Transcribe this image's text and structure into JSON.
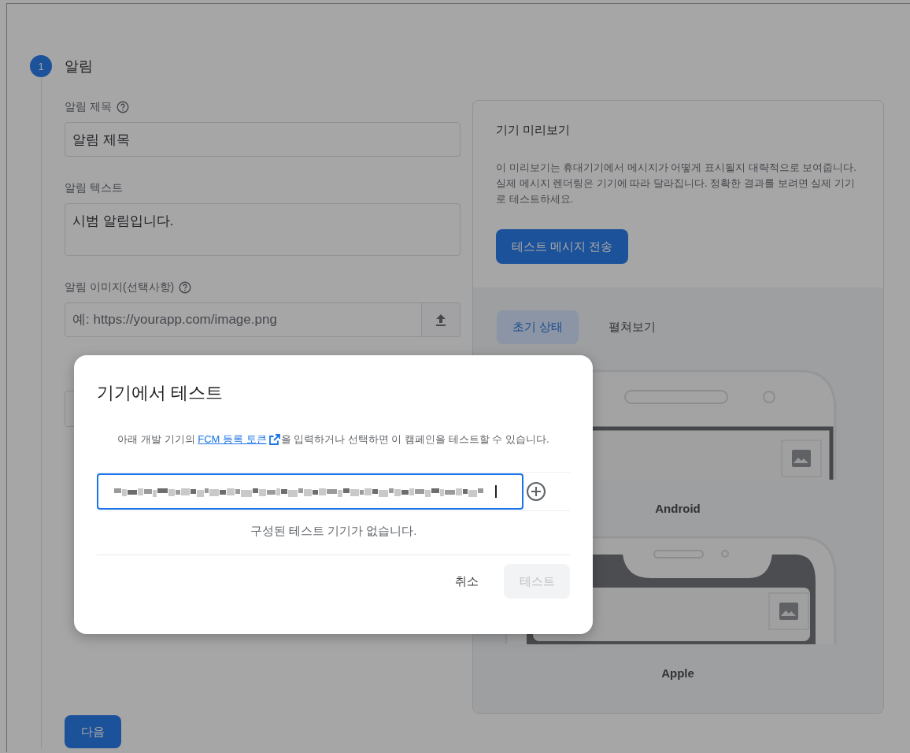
{
  "step": {
    "number": "1",
    "title": "알림"
  },
  "fields": [
    {
      "kind": "text",
      "label": "알림 제목",
      "help": true,
      "value": "알림 제목"
    },
    {
      "kind": "textarea",
      "label": "알림 텍스트",
      "help": false,
      "value": "시범 알림입니다."
    },
    {
      "kind": "upload",
      "label": "알림 이미지(선택사항)",
      "help": true,
      "placeholder": "예: https://yourapp.com/image.png"
    },
    {
      "kind": "covered"
    }
  ],
  "next_button": "다음",
  "preview": {
    "title": "기기 미리보기",
    "description": "이 미리보기는 휴대기기에서 메시지가 어떻게 표시될지 대략적으로 보여줍니다. 실제 메시지 렌더링은 기기에 따라 달라집니다. 정확한 결과를 보려면 실제 기기로 테스트하세요.",
    "send_button": "테스트 메시지 전송",
    "tabs": [
      {
        "label": "초기 상태",
        "selected": true
      },
      {
        "label": "펼쳐보기",
        "selected": false
      }
    ],
    "devices": [
      {
        "kind": "android",
        "label": "Android"
      },
      {
        "kind": "apple",
        "label": "Apple"
      }
    ]
  },
  "dialog": {
    "title": "기기에서 테스트",
    "text_before": "아래 개발 기기의 ",
    "link": "FCM 등록 토큰",
    "text_after": "을 입력하거나 선택하면 이 캠페인을 테스트할 수 있습니다.",
    "token": {
      "focused": true,
      "redacted": true
    },
    "empty_message": "구성된 테스트 기기가 없습니다.",
    "buttons": [
      {
        "label": "취소",
        "disabled": false
      },
      {
        "label": "테스트",
        "disabled": true
      }
    ]
  }
}
